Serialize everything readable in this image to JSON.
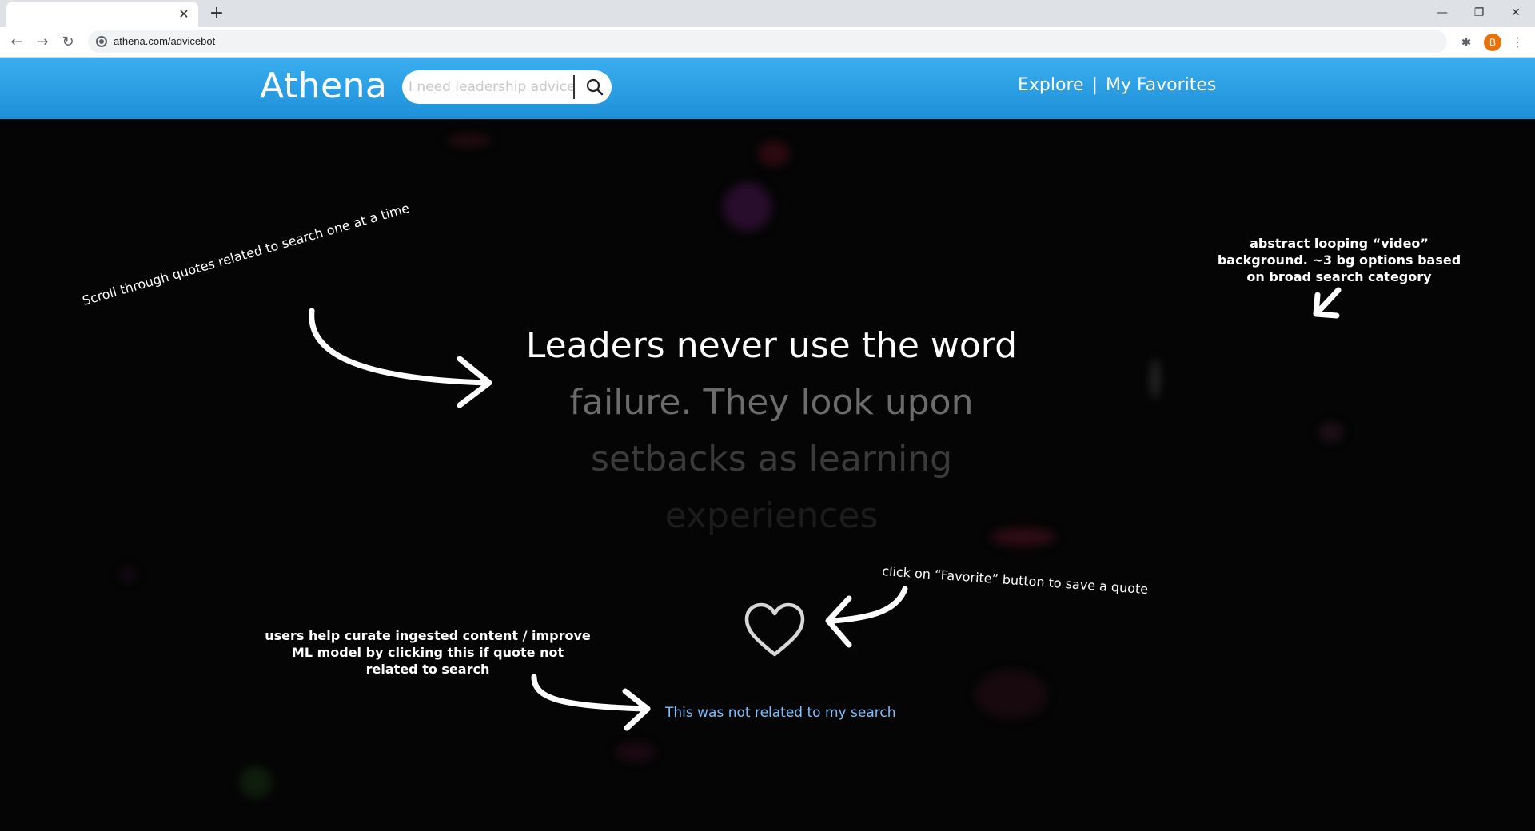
{
  "browser": {
    "tab_close": "✕",
    "new_tab": "+",
    "url": "athena.com/advicebot",
    "profile_initial": "B",
    "window_controls": [
      "—",
      "❐",
      "✕"
    ]
  },
  "header": {
    "logo": "Athena",
    "search": {
      "placeholder": "I need leadership advice",
      "icon": "search-icon"
    },
    "nav": {
      "explore": "Explore",
      "separator": "|",
      "favorites": "My Favorites"
    }
  },
  "quote": {
    "lines": [
      {
        "text": "Leaders never use the word",
        "color": "#ffffff"
      },
      {
        "text": "failure. They look upon",
        "color": "#6c6c6c"
      },
      {
        "text": "setbacks as learning",
        "color": "#3a3a3a"
      },
      {
        "text": "experiences",
        "color": "#1c1c1c"
      }
    ]
  },
  "favorite": {
    "icon": "heart-icon"
  },
  "feedback": {
    "not_related": "This was not related to my search"
  },
  "annotations": {
    "scroll": "Scroll through quotes related to search one at a time",
    "background": "abstract looping “video” background. ~3 bg options based on broad search category",
    "favorite": "click on “Favorite” button to save a quote",
    "curate": "users help curate ingested content / improve ML model by clicking this if quote not related to search"
  },
  "colors": {
    "header_top": "#3aaef0",
    "header_bottom": "#1e90d8",
    "background": "#050505",
    "link": "#7cc0ff"
  }
}
